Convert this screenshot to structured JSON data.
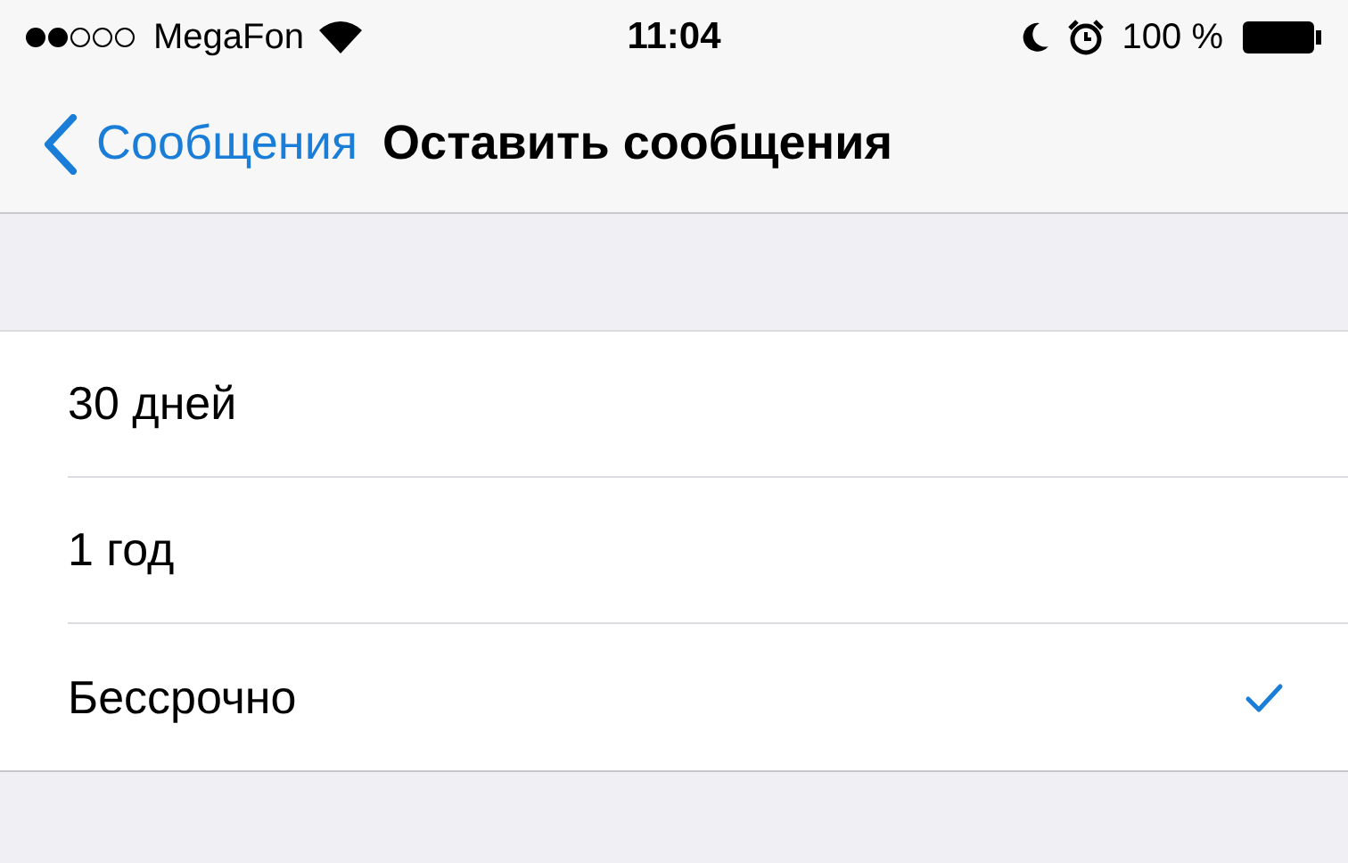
{
  "status_bar": {
    "carrier": "MegaFon",
    "time": "11:04",
    "battery": "100 %"
  },
  "nav_bar": {
    "back_label": "Сообщения",
    "title": "Оставить сообщения"
  },
  "options": [
    {
      "label": "30 дней",
      "selected": false
    },
    {
      "label": "1 год",
      "selected": false
    },
    {
      "label": "Бессрочно",
      "selected": true
    }
  ]
}
